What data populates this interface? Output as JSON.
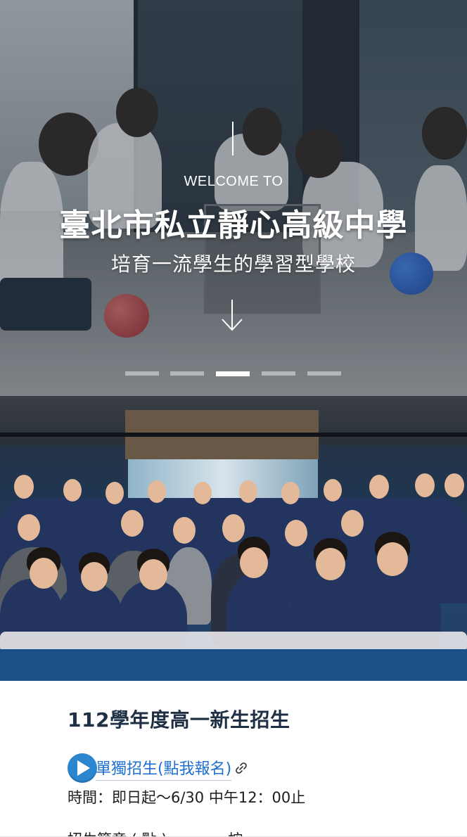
{
  "hero": {
    "welcome": "WELCOME TO",
    "title": "臺北市私立靜心高級中學",
    "subtitle": "培育一流學生的學習型學校",
    "slides": 5,
    "active_slide": 3
  },
  "section": {
    "title": "112學年度高一新生招生",
    "link_label": "單獨招生(點我報名)",
    "time_text": "時間：即日起～6/30 中午12：00止",
    "next_line_partial": "招生簡章 ( 點 ) . . . . . . 按"
  },
  "colors": {
    "title": "#1f2f44",
    "link": "#1e6fd1",
    "play_icon": "#2b86cf"
  },
  "icons": {
    "scroll": "arrow-down-icon",
    "play": "play-icon",
    "link": "link-icon"
  }
}
